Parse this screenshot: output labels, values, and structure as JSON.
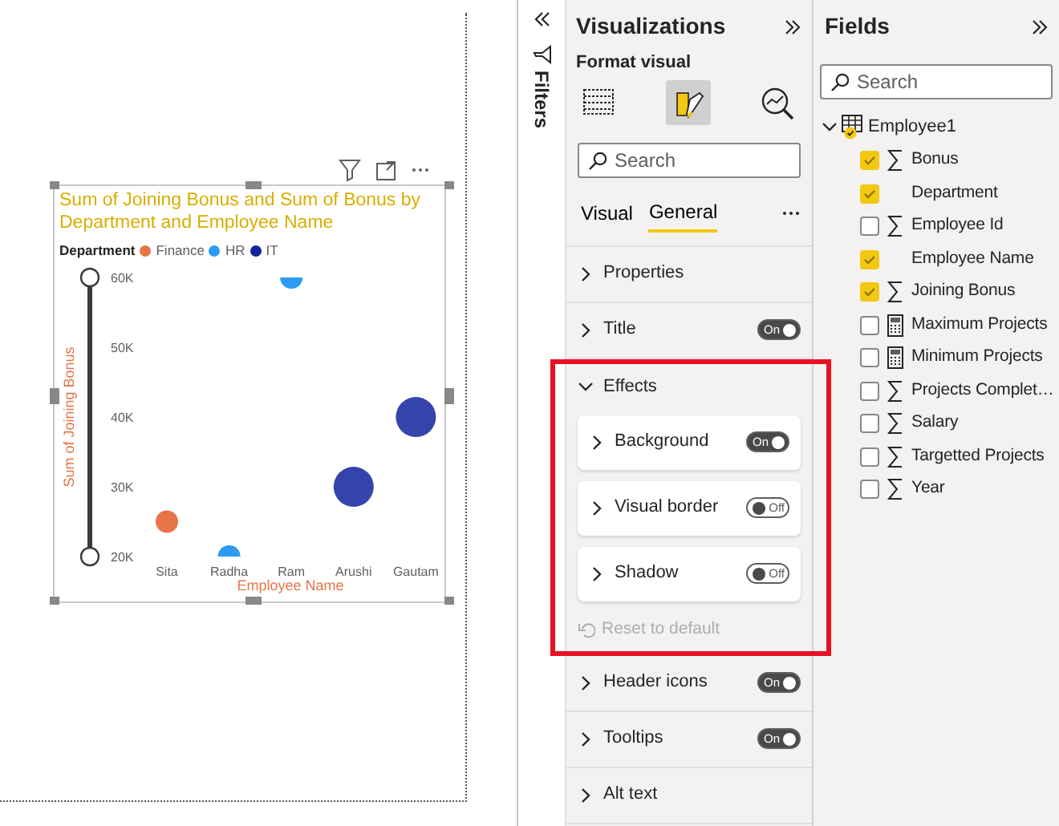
{
  "canvas": {
    "visual": {
      "title": "Sum of Joining Bonus and Sum of Bonus by Department and Employee Name",
      "legend_title": "Department",
      "chart_data": {
        "type": "scatter",
        "xlabel": "Employee Name",
        "ylabel": "Sum of Joining Bonus",
        "categories": [
          "Sita",
          "Radha",
          "Ram",
          "Arushi",
          "Gautam"
        ],
        "series": [
          {
            "name": "Finance",
            "color": "#e8744a",
            "values": [
              25000,
              null,
              null,
              null,
              null
            ]
          },
          {
            "name": "HR",
            "color": "#2b9bf4",
            "values": [
              null,
              20000,
              60000,
              null,
              null
            ]
          },
          {
            "name": "IT",
            "color": "#12239e",
            "values": [
              null,
              null,
              null,
              30000,
              40000
            ]
          }
        ],
        "ylim": [
          20000,
          60000
        ],
        "yticks": [
          {
            "value": 20000,
            "label": "20K"
          },
          {
            "value": 30000,
            "label": "30K"
          },
          {
            "value": 40000,
            "label": "40K"
          },
          {
            "value": 50000,
            "label": "50K"
          },
          {
            "value": 60000,
            "label": "60K"
          }
        ]
      }
    }
  },
  "filters": {
    "label": "Filters"
  },
  "visualizations": {
    "title": "Visualizations",
    "subtitle": "Format visual",
    "modes": [
      {
        "kind": "fields",
        "selected": false
      },
      {
        "kind": "format",
        "selected": true
      },
      {
        "kind": "analytics",
        "selected": false
      }
    ],
    "search": {
      "placeholder": "Search"
    },
    "tabs": [
      {
        "label": "Visual",
        "selected": false
      },
      {
        "label": "General",
        "selected": true
      }
    ],
    "sections": [
      {
        "label": "Properties",
        "expanded": false
      },
      {
        "label": "Title",
        "expanded": false,
        "toggle": {
          "on": true,
          "label": "On"
        }
      },
      {
        "label": "Effects",
        "expanded": true,
        "highlighted": true,
        "children": [
          {
            "label": "Background",
            "toggle": {
              "on": true,
              "label": "On"
            }
          },
          {
            "label": "Visual border",
            "toggle": {
              "on": false,
              "label": "Off"
            }
          },
          {
            "label": "Shadow",
            "toggle": {
              "on": false,
              "label": "Off"
            }
          }
        ],
        "reset": {
          "label": "Reset to default",
          "disabled": true
        }
      },
      {
        "label": "Header icons",
        "expanded": false,
        "toggle": {
          "on": true,
          "label": "On"
        }
      },
      {
        "label": "Tooltips",
        "expanded": false,
        "toggle": {
          "on": true,
          "label": "On"
        }
      },
      {
        "label": "Alt text",
        "expanded": false
      }
    ]
  },
  "fields": {
    "title": "Fields",
    "search": {
      "placeholder": "Search"
    },
    "tables": [
      {
        "name": "Employee1",
        "expanded": true,
        "checked": true,
        "children": [
          {
            "name": "Bonus",
            "kind": "sum",
            "checked": true
          },
          {
            "name": "Department",
            "kind": "text",
            "checked": true
          },
          {
            "name": "Employee Id",
            "kind": "sum",
            "checked": false
          },
          {
            "name": "Employee Name",
            "kind": "text",
            "checked": true
          },
          {
            "name": "Joining Bonus",
            "kind": "sum",
            "checked": true
          },
          {
            "name": "Maximum Projects",
            "kind": "measure",
            "checked": false
          },
          {
            "name": "Minimum Projects",
            "kind": "measure",
            "checked": false
          },
          {
            "name": "Projects Complet…",
            "kind": "sum",
            "checked": false
          },
          {
            "name": "Salary",
            "kind": "sum",
            "checked": false
          },
          {
            "name": "Targetted Projects",
            "kind": "sum",
            "checked": false
          },
          {
            "name": "Year",
            "kind": "sum",
            "checked": false
          }
        ]
      }
    ]
  }
}
